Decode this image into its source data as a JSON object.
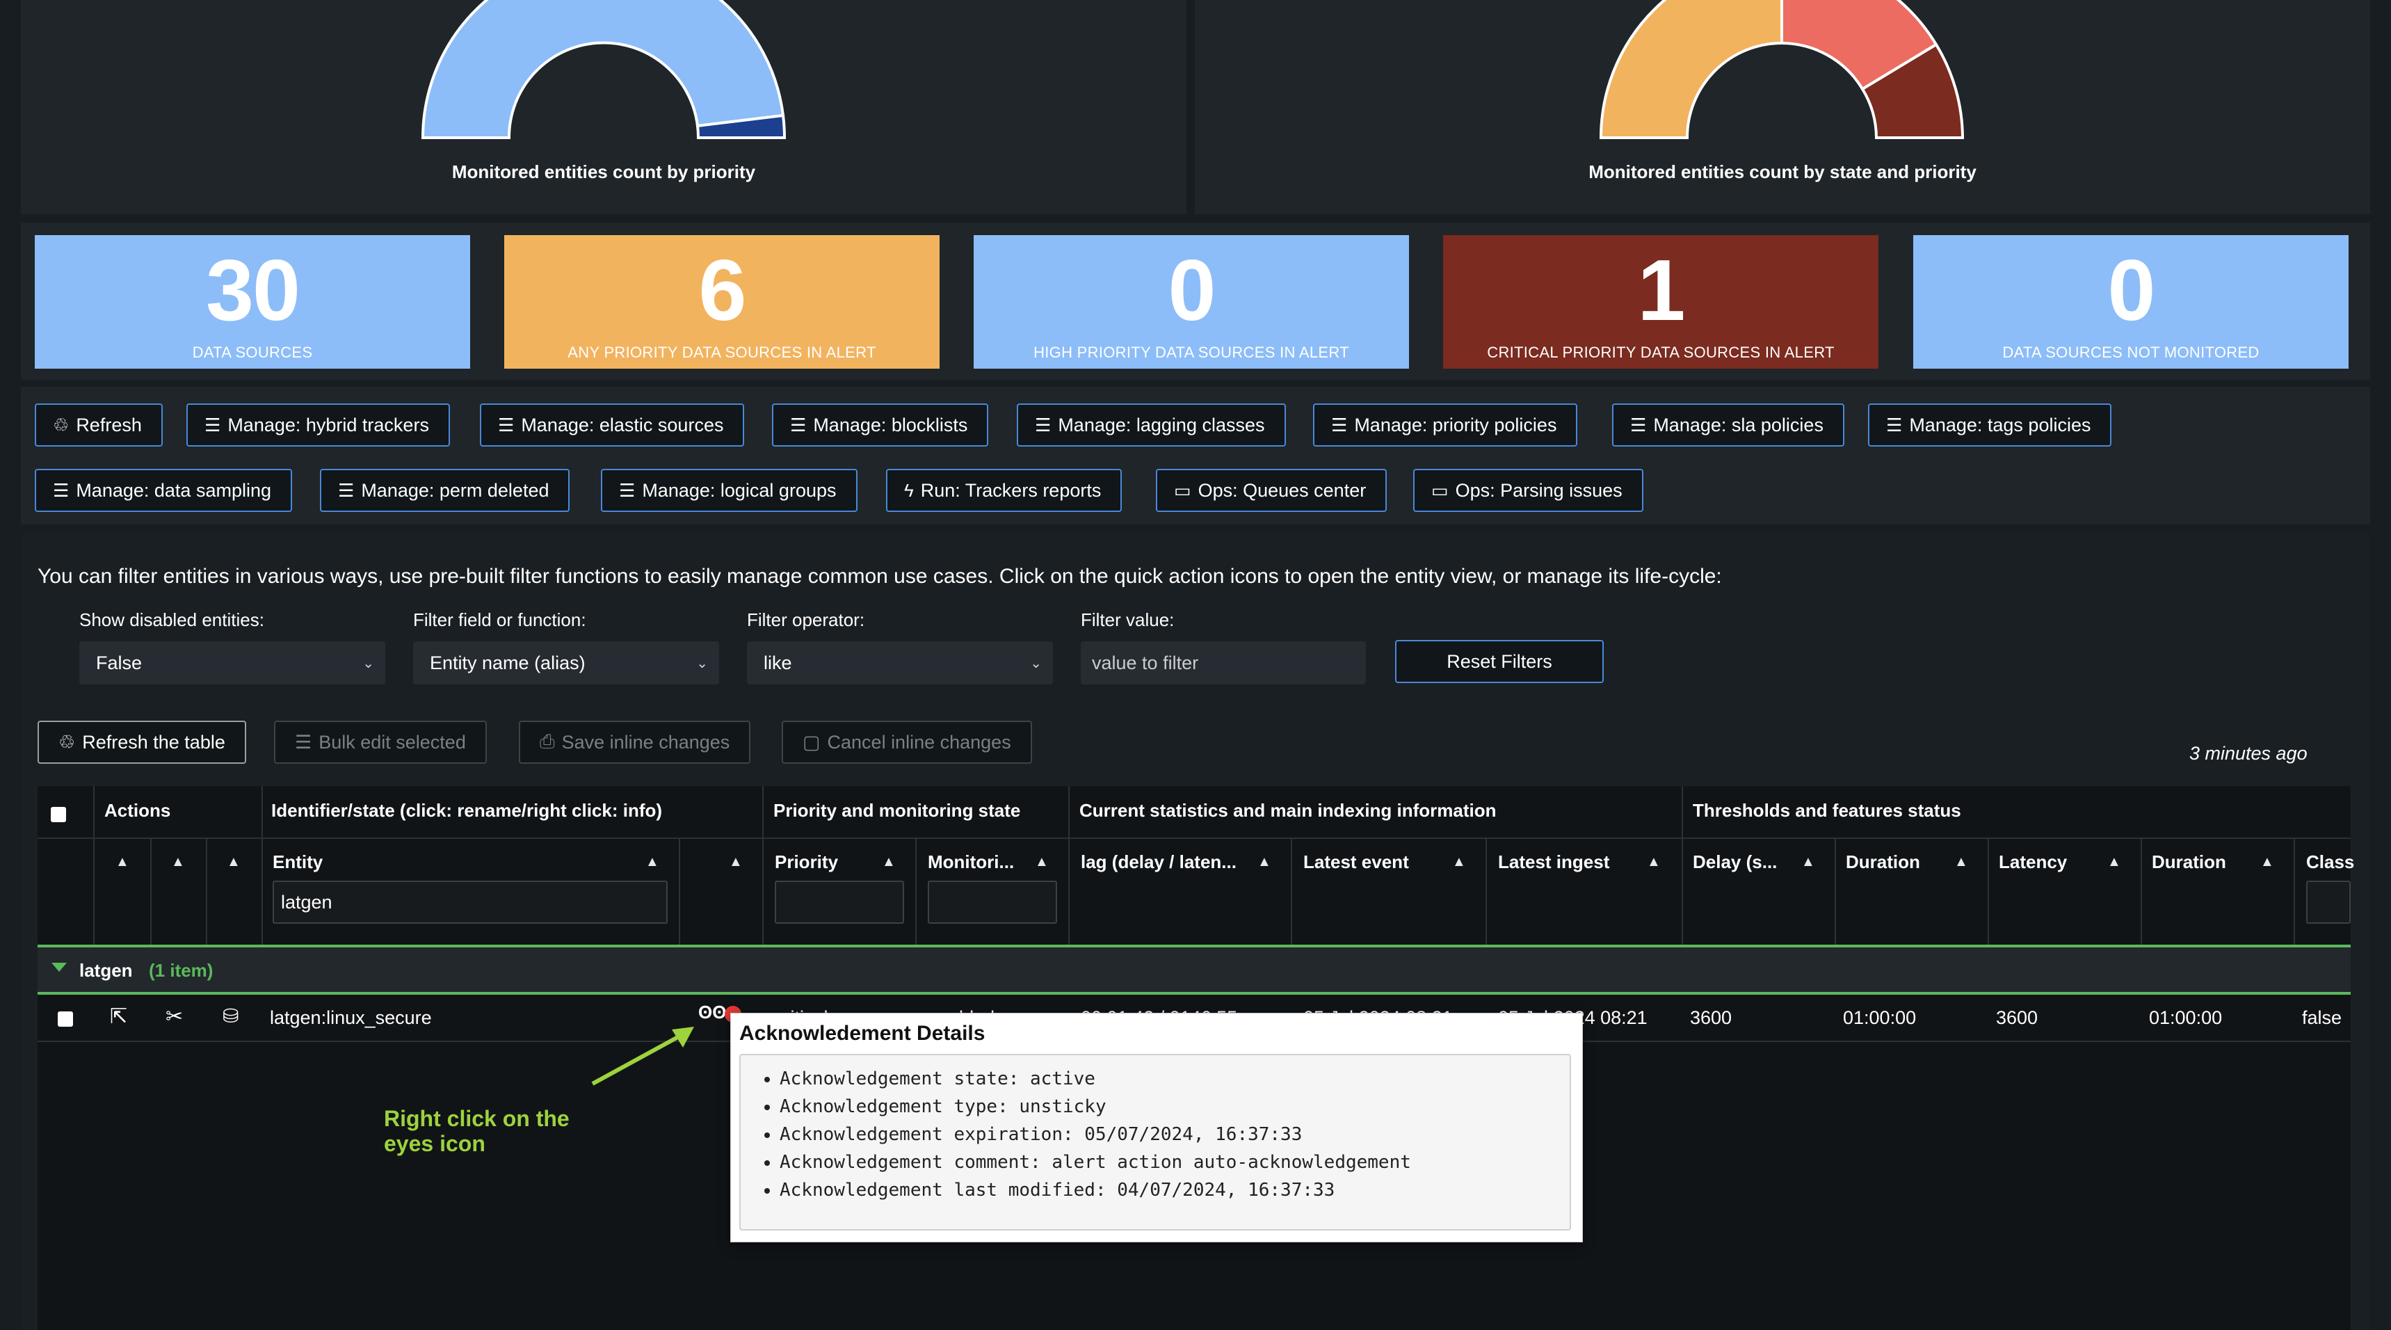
{
  "charts": {
    "priority_title": "Monitored entities count by priority",
    "state_title": "Monitored entities count by state and priority"
  },
  "kpis": [
    {
      "value": "30",
      "label": "DATA SOURCES",
      "color": "#8cbdf8"
    },
    {
      "value": "6",
      "label": "ANY PRIORITY DATA SOURCES IN ALERT",
      "color": "#f2b35f"
    },
    {
      "value": "0",
      "label": "HIGH PRIORITY DATA SOURCES IN ALERT",
      "color": "#8cbdf8"
    },
    {
      "value": "1",
      "label": "CRITICAL PRIORITY DATA SOURCES IN ALERT",
      "color": "#7b2b1f"
    },
    {
      "value": "0",
      "label": "DATA SOURCES NOT MONITORED",
      "color": "#8cbdf8"
    }
  ],
  "buttons_row1": [
    "Refresh",
    "Manage: hybrid trackers",
    "Manage: elastic sources",
    "Manage: blocklists",
    "Manage: lagging classes",
    "Manage: priority policies",
    "Manage: sla policies",
    "Manage: tags policies"
  ],
  "buttons_row2": [
    "Manage: data sampling",
    "Manage: perm deleted",
    "Manage: logical groups",
    "Run: Trackers reports",
    "Ops: Queues center",
    "Ops: Parsing issues"
  ],
  "filter": {
    "intro": "You can filter entities in various ways, use pre-built filter functions to easily manage common use cases. Click on the quick action icons to open the entity view, or manage its life-cycle:",
    "disabled_label": "Show disabled entities:",
    "disabled_value": "False",
    "field_label": "Filter field or function:",
    "field_value": "Entity name (alias)",
    "operator_label": "Filter operator:",
    "operator_value": "like",
    "value_label": "Filter value:",
    "value_placeholder": "value to filter",
    "reset": "Reset Filters"
  },
  "table_actions": {
    "refresh": "Refresh the table",
    "bulk": "Bulk edit selected",
    "save": "Save inline changes",
    "cancel": "Cancel inline changes",
    "updated": "3 minutes ago"
  },
  "table": {
    "groups": [
      "Actions",
      "Identifier/state (click: rename/right click: info)",
      "Priority and monitoring state",
      "Current statistics and main indexing information",
      "Thresholds and features status"
    ],
    "columns": [
      "Entity",
      "Priority",
      "Monitori...",
      "lag (delay / laten...",
      "Latest event",
      "Latest ingest",
      "Delay (s...",
      "Duration",
      "Latency",
      "Duration",
      "Class"
    ],
    "entity_filter": "latgen",
    "group_name": "latgen",
    "group_count": "(1 item)",
    "row": {
      "entity": "latgen:linux_secure",
      "priority": "critical",
      "monitoring": "enabled",
      "lag": "00:01:42 / 0146:55",
      "latest_event": "05 Jul 2024 08:21",
      "latest_ingest": "05 Jul 2024 08:21",
      "delay": "3600",
      "duration1": "01:00:00",
      "latency": "3600",
      "duration2": "01:00:00",
      "class": "false"
    }
  },
  "popup": {
    "title": "Acknowledement Details",
    "items": [
      "Acknowledgement state: active",
      "Acknowledgement type: unsticky",
      "Acknowledgement expiration: 05/07/2024, 16:37:33",
      "Acknowledgement comment: alert action auto-acknowledgement",
      "Acknowledgement last modified: 04/07/2024, 16:37:33"
    ]
  },
  "annotation": {
    "line1": "Right click on the",
    "line2": "eyes icon",
    "color": "#9dd33c"
  }
}
